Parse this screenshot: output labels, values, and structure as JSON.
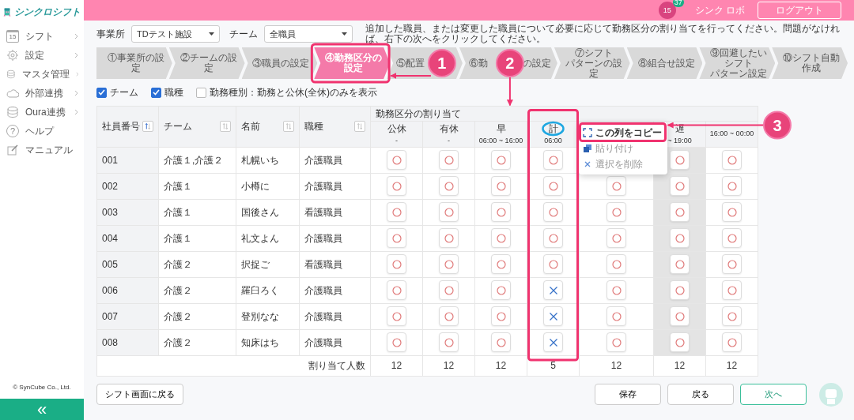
{
  "sidebar": {
    "logo": "シンクロシフト",
    "items": [
      {
        "label": "シフト",
        "calendar_day": "15",
        "submenu": true
      },
      {
        "label": "設定",
        "submenu": true
      },
      {
        "label": "マスタ管理",
        "submenu": true
      },
      {
        "label": "外部連携",
        "submenu": true
      },
      {
        "label": "Oura連携",
        "submenu": true
      },
      {
        "label": "ヘルプ",
        "icon_text": "?",
        "submenu": false
      },
      {
        "label": "マニュアル",
        "submenu": false
      }
    ],
    "copyright": "© SynCube Co., Ltd.",
    "collapse_button": "«"
  },
  "header": {
    "calendar_day": "15",
    "notification_count": "37",
    "user": "シンク ロボ",
    "logout_button": "ログアウト"
  },
  "filters": [
    {
      "label": "事業所",
      "value": "TDテスト施設"
    },
    {
      "label": "チーム",
      "value": "全職員"
    }
  ],
  "instruction": "追加した職員、または変更した職員について必要に応じて勤務区分の割り当てを行ってください。問題がなければ、右下の次へをクリックしてください。",
  "steps": [
    {
      "lines": [
        "①事業所の設定"
      ],
      "selected": false
    },
    {
      "lines": [
        "②チームの設定"
      ],
      "selected": false
    },
    {
      "lines": [
        "③職員の設定"
      ],
      "selected": false
    },
    {
      "lines": [
        "④勤務区分の設定"
      ],
      "selected": true
    },
    {
      "lines": [
        "⑤配置"
      ],
      "selected": false
    },
    {
      "lines": [
        "⑥勤"
      ],
      "tail": "の設定",
      "selected": false
    },
    {
      "lines": [
        "⑦シフト",
        "パターンの設定"
      ],
      "selected": false
    },
    {
      "lines": [
        "⑧組合せ設定"
      ],
      "selected": false
    },
    {
      "lines": [
        "⑨回避したいシフト",
        "パターン設定"
      ],
      "selected": false
    },
    {
      "lines": [
        "⑩シフト自動作成"
      ],
      "selected": false
    }
  ],
  "checkboxes": [
    {
      "label": "チーム",
      "checked": true
    },
    {
      "label": "職種",
      "checked": true
    },
    {
      "label": "勤務種別：勤務と公休(全休)のみを表示",
      "checked": false
    }
  ],
  "table": {
    "columns": [
      {
        "label": "社員番号",
        "sorted": true
      },
      {
        "label": "チーム",
        "sorted": false
      },
      {
        "label": "名前",
        "sorted": false
      },
      {
        "label": "職種",
        "sorted": false
      }
    ],
    "group_header": "勤務区分の割り当て",
    "shift_columns": [
      {
        "label": "公休",
        "time": "-",
        "shaded": false
      },
      {
        "label": "有休",
        "time": "-",
        "shaded": false
      },
      {
        "label": "早",
        "time": "06:00 ~ 16:00",
        "shaded": false
      },
      {
        "label": "計",
        "time": "06:00",
        "shaded": false
      },
      {
        "shaded": false
      },
      {
        "label": "遅",
        "time": "~ 19:00",
        "shaded": true
      },
      {
        "time": "16:00 ~ 00:00",
        "shaded": false
      }
    ],
    "rows": [
      {
        "id": "001",
        "team": "介護１,介護２",
        "name": "札幌いち",
        "job": "介護職員",
        "cells": [
          true,
          true,
          true,
          true,
          null,
          true,
          true
        ]
      },
      {
        "id": "002",
        "team": "介護１",
        "name": "小樽に",
        "job": "介護職員",
        "cells": [
          true,
          true,
          true,
          true,
          true,
          true,
          true
        ]
      },
      {
        "id": "003",
        "team": "介護１",
        "name": "国後さん",
        "job": "看護職員",
        "cells": [
          true,
          true,
          true,
          true,
          true,
          true,
          true
        ]
      },
      {
        "id": "004",
        "team": "介護１",
        "name": "礼文よん",
        "job": "介護職員",
        "cells": [
          true,
          true,
          true,
          true,
          true,
          true,
          true
        ]
      },
      {
        "id": "005",
        "team": "介護２",
        "name": "択捉ご",
        "job": "看護職員",
        "cells": [
          true,
          true,
          true,
          true,
          true,
          true,
          true
        ]
      },
      {
        "id": "006",
        "team": "介護２",
        "name": "羅臼ろく",
        "job": "介護職員",
        "cells": [
          true,
          true,
          true,
          false,
          true,
          true,
          true
        ]
      },
      {
        "id": "007",
        "team": "介護２",
        "name": "登別なな",
        "job": "介護職員",
        "cells": [
          true,
          true,
          true,
          false,
          true,
          true,
          true
        ]
      },
      {
        "id": "008",
        "team": "介護２",
        "name": "知床はち",
        "job": "介護職員",
        "cells": [
          true,
          true,
          true,
          false,
          true,
          true,
          true
        ]
      }
    ],
    "totals_label": "割り当て人数",
    "totals": [
      "12",
      "12",
      "12",
      "5",
      "12",
      "12",
      "12"
    ]
  },
  "context_menu": [
    {
      "label": "この列をコピー",
      "disabled": false
    },
    {
      "label": "貼り付け",
      "disabled": true
    },
    {
      "label": "選択を削除",
      "disabled": true
    }
  ],
  "footer": {
    "back_to_shift": "シフト画面に戻る",
    "buttons": [
      {
        "label": "保存",
        "primary": false
      },
      {
        "label": "戻る",
        "primary": false
      },
      {
        "label": "次へ",
        "primary": true
      }
    ]
  },
  "callouts": [
    "1",
    "2",
    "3"
  ]
}
